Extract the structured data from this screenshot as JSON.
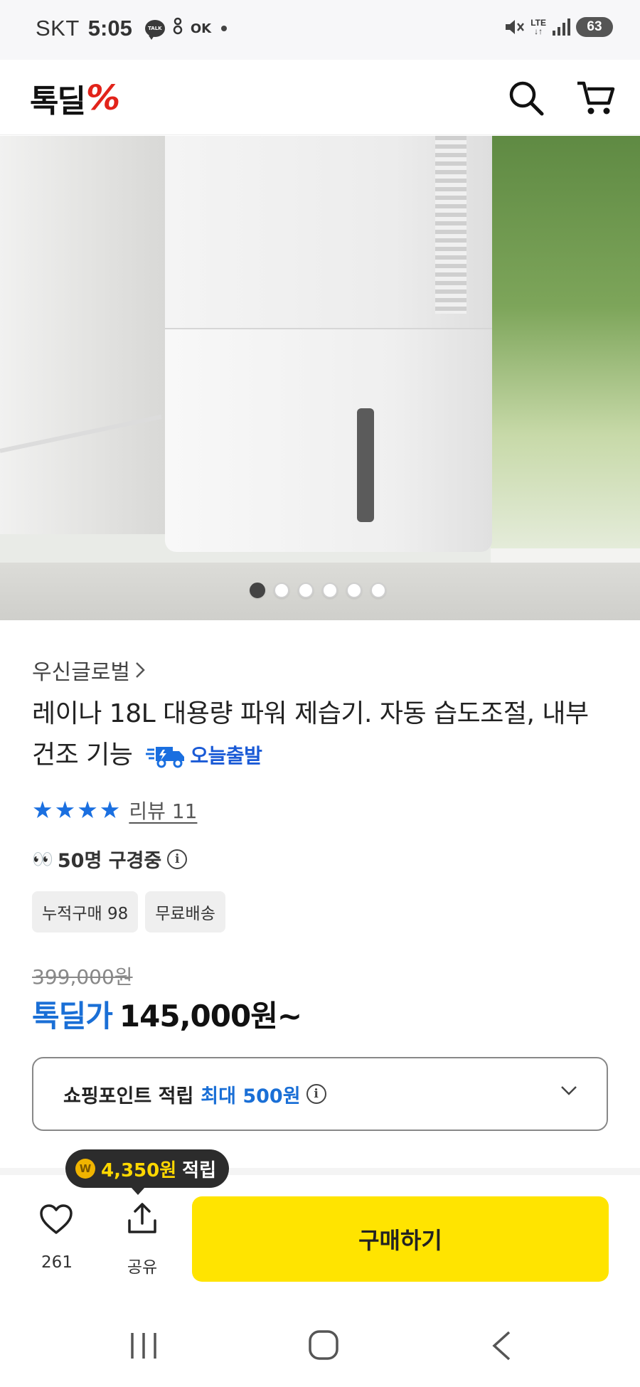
{
  "status_bar": {
    "carrier": "SKT",
    "time": "5:05",
    "talk_icon_text": "TALK",
    "ok_icon_text": "OK",
    "network": "LTE",
    "battery": "63",
    "icons": [
      "kakaotalk-icon",
      "accessibility-icon",
      "ok-cashbag-icon",
      "notification-dot-icon",
      "mute-icon",
      "lte-icon",
      "signal-icon",
      "battery-icon"
    ]
  },
  "header": {
    "logo_text": "톡딜",
    "logo_mark": "%",
    "icons": [
      "search-icon",
      "cart-icon"
    ],
    "accent_color": "#e2231a"
  },
  "gallery": {
    "image_description_icon": "product-photo",
    "dots": [
      true,
      false,
      false,
      false,
      false,
      false
    ]
  },
  "product": {
    "seller": "우신글로벌",
    "title": "레이나 18L 대용량 파워 제습기. 자동 습도조절, 내부 건조 기능",
    "today_ship_badge": "오늘출발",
    "rating_stars": 4,
    "review_label": "리뷰 11",
    "viewers": "50명 구경중",
    "chips": [
      "누적구매 98",
      "무료배송"
    ],
    "original_price": "399,000원",
    "price_label": "톡딜가",
    "price": "145,000원~",
    "points_label": "쇼핑포인트 적립",
    "points_max": "최대 500원"
  },
  "bottom_bar": {
    "reward_amount": "4,350원",
    "reward_suffix": "적립",
    "coin_text": "W",
    "like_count": "261",
    "share_label": "공유",
    "buy_label": "구매하기",
    "buy_color": "#ffe400"
  },
  "colors": {
    "accent_blue": "#1a6fd6",
    "price_blue": "#1a6fd6"
  }
}
